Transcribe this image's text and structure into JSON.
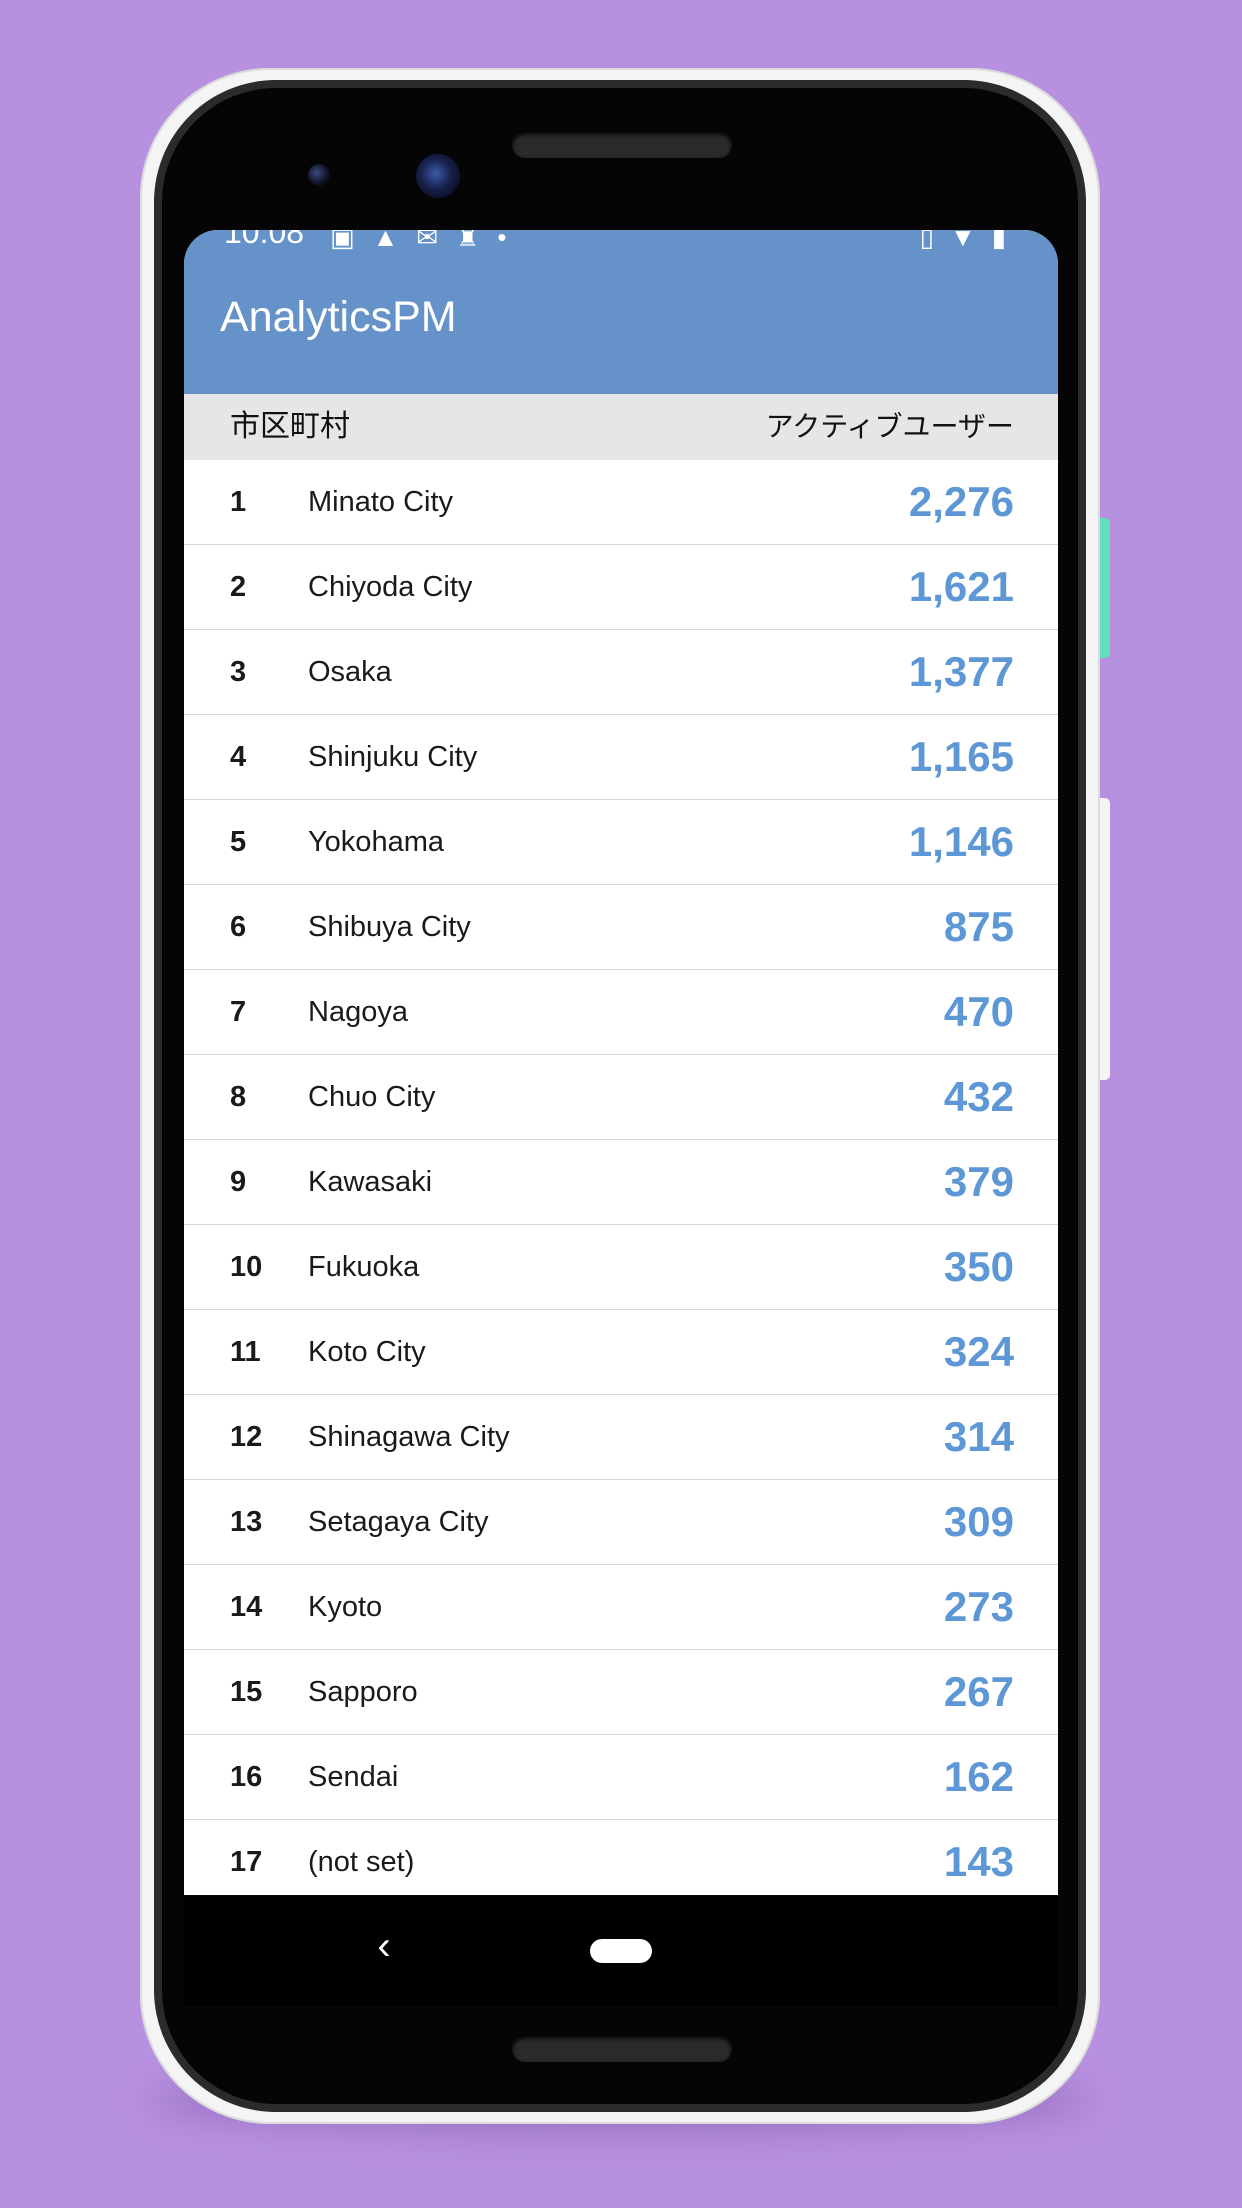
{
  "status_bar": {
    "time": "10:08",
    "left_icons": [
      "image-icon",
      "alert-icon",
      "mail-icon",
      "signal-tower-icon",
      "dot-icon"
    ],
    "right_icons": [
      "vibrate-icon",
      "wifi-icon",
      "battery-charging-icon"
    ]
  },
  "app_bar": {
    "title": "AnalyticsPM",
    "color": "#6593c9"
  },
  "table": {
    "header_city": "市区町村",
    "header_users": "アクティブユーザー",
    "value_color": "#5d97d6",
    "rows": [
      {
        "rank": "1",
        "city": "Minato City",
        "users": "2,276"
      },
      {
        "rank": "2",
        "city": "Chiyoda City",
        "users": "1,621"
      },
      {
        "rank": "3",
        "city": "Osaka",
        "users": "1,377"
      },
      {
        "rank": "4",
        "city": "Shinjuku City",
        "users": "1,165"
      },
      {
        "rank": "5",
        "city": "Yokohama",
        "users": "1,146"
      },
      {
        "rank": "6",
        "city": "Shibuya City",
        "users": "875"
      },
      {
        "rank": "7",
        "city": "Nagoya",
        "users": "470"
      },
      {
        "rank": "8",
        "city": "Chuo City",
        "users": "432"
      },
      {
        "rank": "9",
        "city": "Kawasaki",
        "users": "379"
      },
      {
        "rank": "10",
        "city": "Fukuoka",
        "users": "350"
      },
      {
        "rank": "11",
        "city": "Koto City",
        "users": "324"
      },
      {
        "rank": "12",
        "city": "Shinagawa City",
        "users": "314"
      },
      {
        "rank": "13",
        "city": "Setagaya City",
        "users": "309"
      },
      {
        "rank": "14",
        "city": "Kyoto",
        "users": "273"
      },
      {
        "rank": "15",
        "city": "Sapporo",
        "users": "267"
      },
      {
        "rank": "16",
        "city": "Sendai",
        "users": "162"
      },
      {
        "rank": "17",
        "city": "(not set)",
        "users": "143"
      }
    ]
  },
  "nav_bar": {
    "back_icon": "back-chevron-icon",
    "home_icon": "home-pill-icon"
  }
}
